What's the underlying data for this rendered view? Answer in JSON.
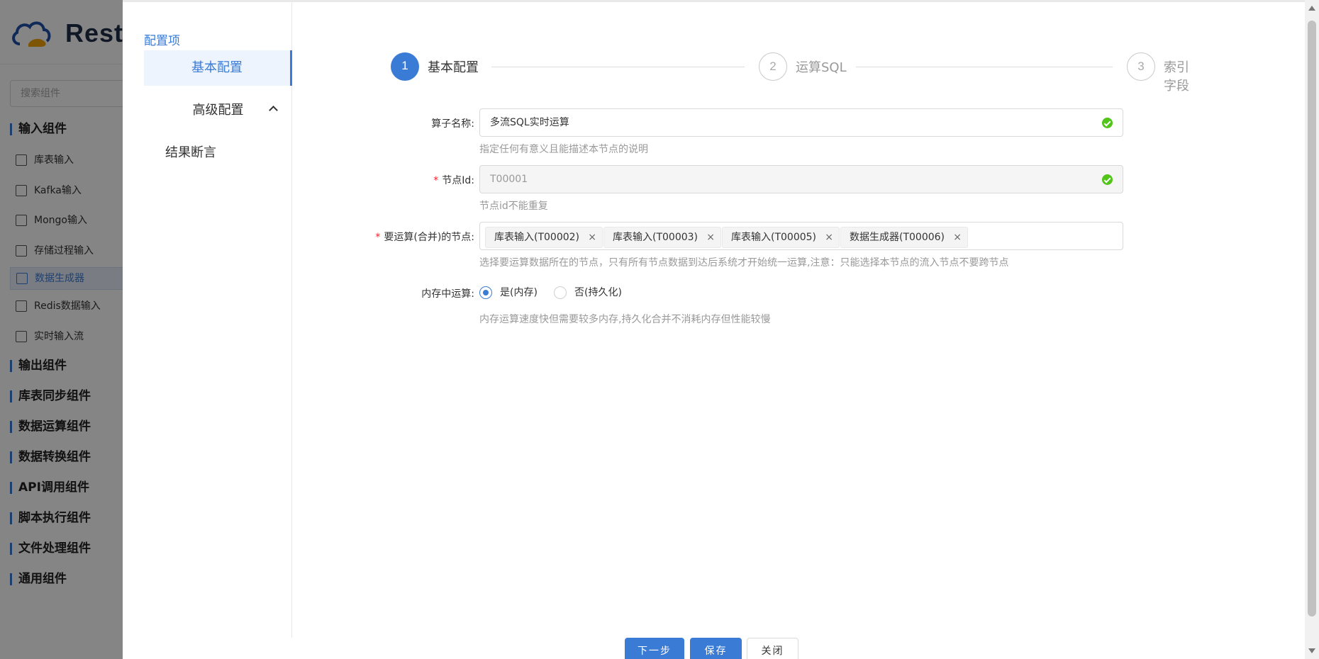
{
  "background": {
    "brand": "Rest(",
    "search_placeholder": "搜索组件",
    "input_group": "输入组件",
    "input_items": [
      {
        "label": "库表输入",
        "icon": "table-input-icon"
      },
      {
        "label": "Kafka输入",
        "icon": "kafka-icon"
      },
      {
        "label": "Mongo输入",
        "icon": "mongo-icon"
      },
      {
        "label": "存储过程输入",
        "icon": "procedure-icon"
      },
      {
        "label": "数据生成器",
        "icon": "generator-icon"
      },
      {
        "label": "Redis数据输入",
        "icon": "redis-icon"
      },
      {
        "label": "实时输入流",
        "icon": "stream-icon"
      }
    ],
    "groups": [
      "输出组件",
      "库表同步组件",
      "数据运算组件",
      "数据转换组件",
      "API调用组件",
      "脚本执行组件",
      "文件处理组件",
      "通用组件"
    ]
  },
  "sidebar": {
    "title": "配置项",
    "basic": "基本配置",
    "advanced": "高级配置",
    "result": "结果断言"
  },
  "steps": [
    {
      "num": "1",
      "label": "基本配置"
    },
    {
      "num": "2",
      "label": "运算SQL"
    },
    {
      "num": "3",
      "label": "索引字段"
    }
  ],
  "form": {
    "name_label": "算子名称:",
    "name_value": "多流SQL实时运算",
    "name_hint": "指定任何有意义且能描述本节点的说明",
    "id_label": "节点Id:",
    "id_value": "T00001",
    "id_hint": "节点id不能重复",
    "nodes_label": "要运算(合并)的节点:",
    "nodes": [
      "库表输入(T00002)",
      "库表输入(T00003)",
      "库表输入(T00005)",
      "数据生成器(T00006)"
    ],
    "nodes_hint": "选择要运算数据所在的节点，只有所有节点数据到达后系统才开始统一运算,注意：只能选择本节点的流入节点不要跨节点",
    "mem_label": "内存中运算:",
    "mem_yes": "是(内存)",
    "mem_no": "否(持久化)",
    "mem_hint": "内存运算速度快但需要较多内存,持久化合并不消耗内存但性能较慢",
    "required_mark": "*",
    "tag_close": "×"
  },
  "footer": {
    "next": "下一步",
    "save": "保存",
    "close": "关闭"
  },
  "colors": {
    "primary": "#3a7bd5",
    "success": "#52c41a",
    "required": "#f5222d"
  }
}
